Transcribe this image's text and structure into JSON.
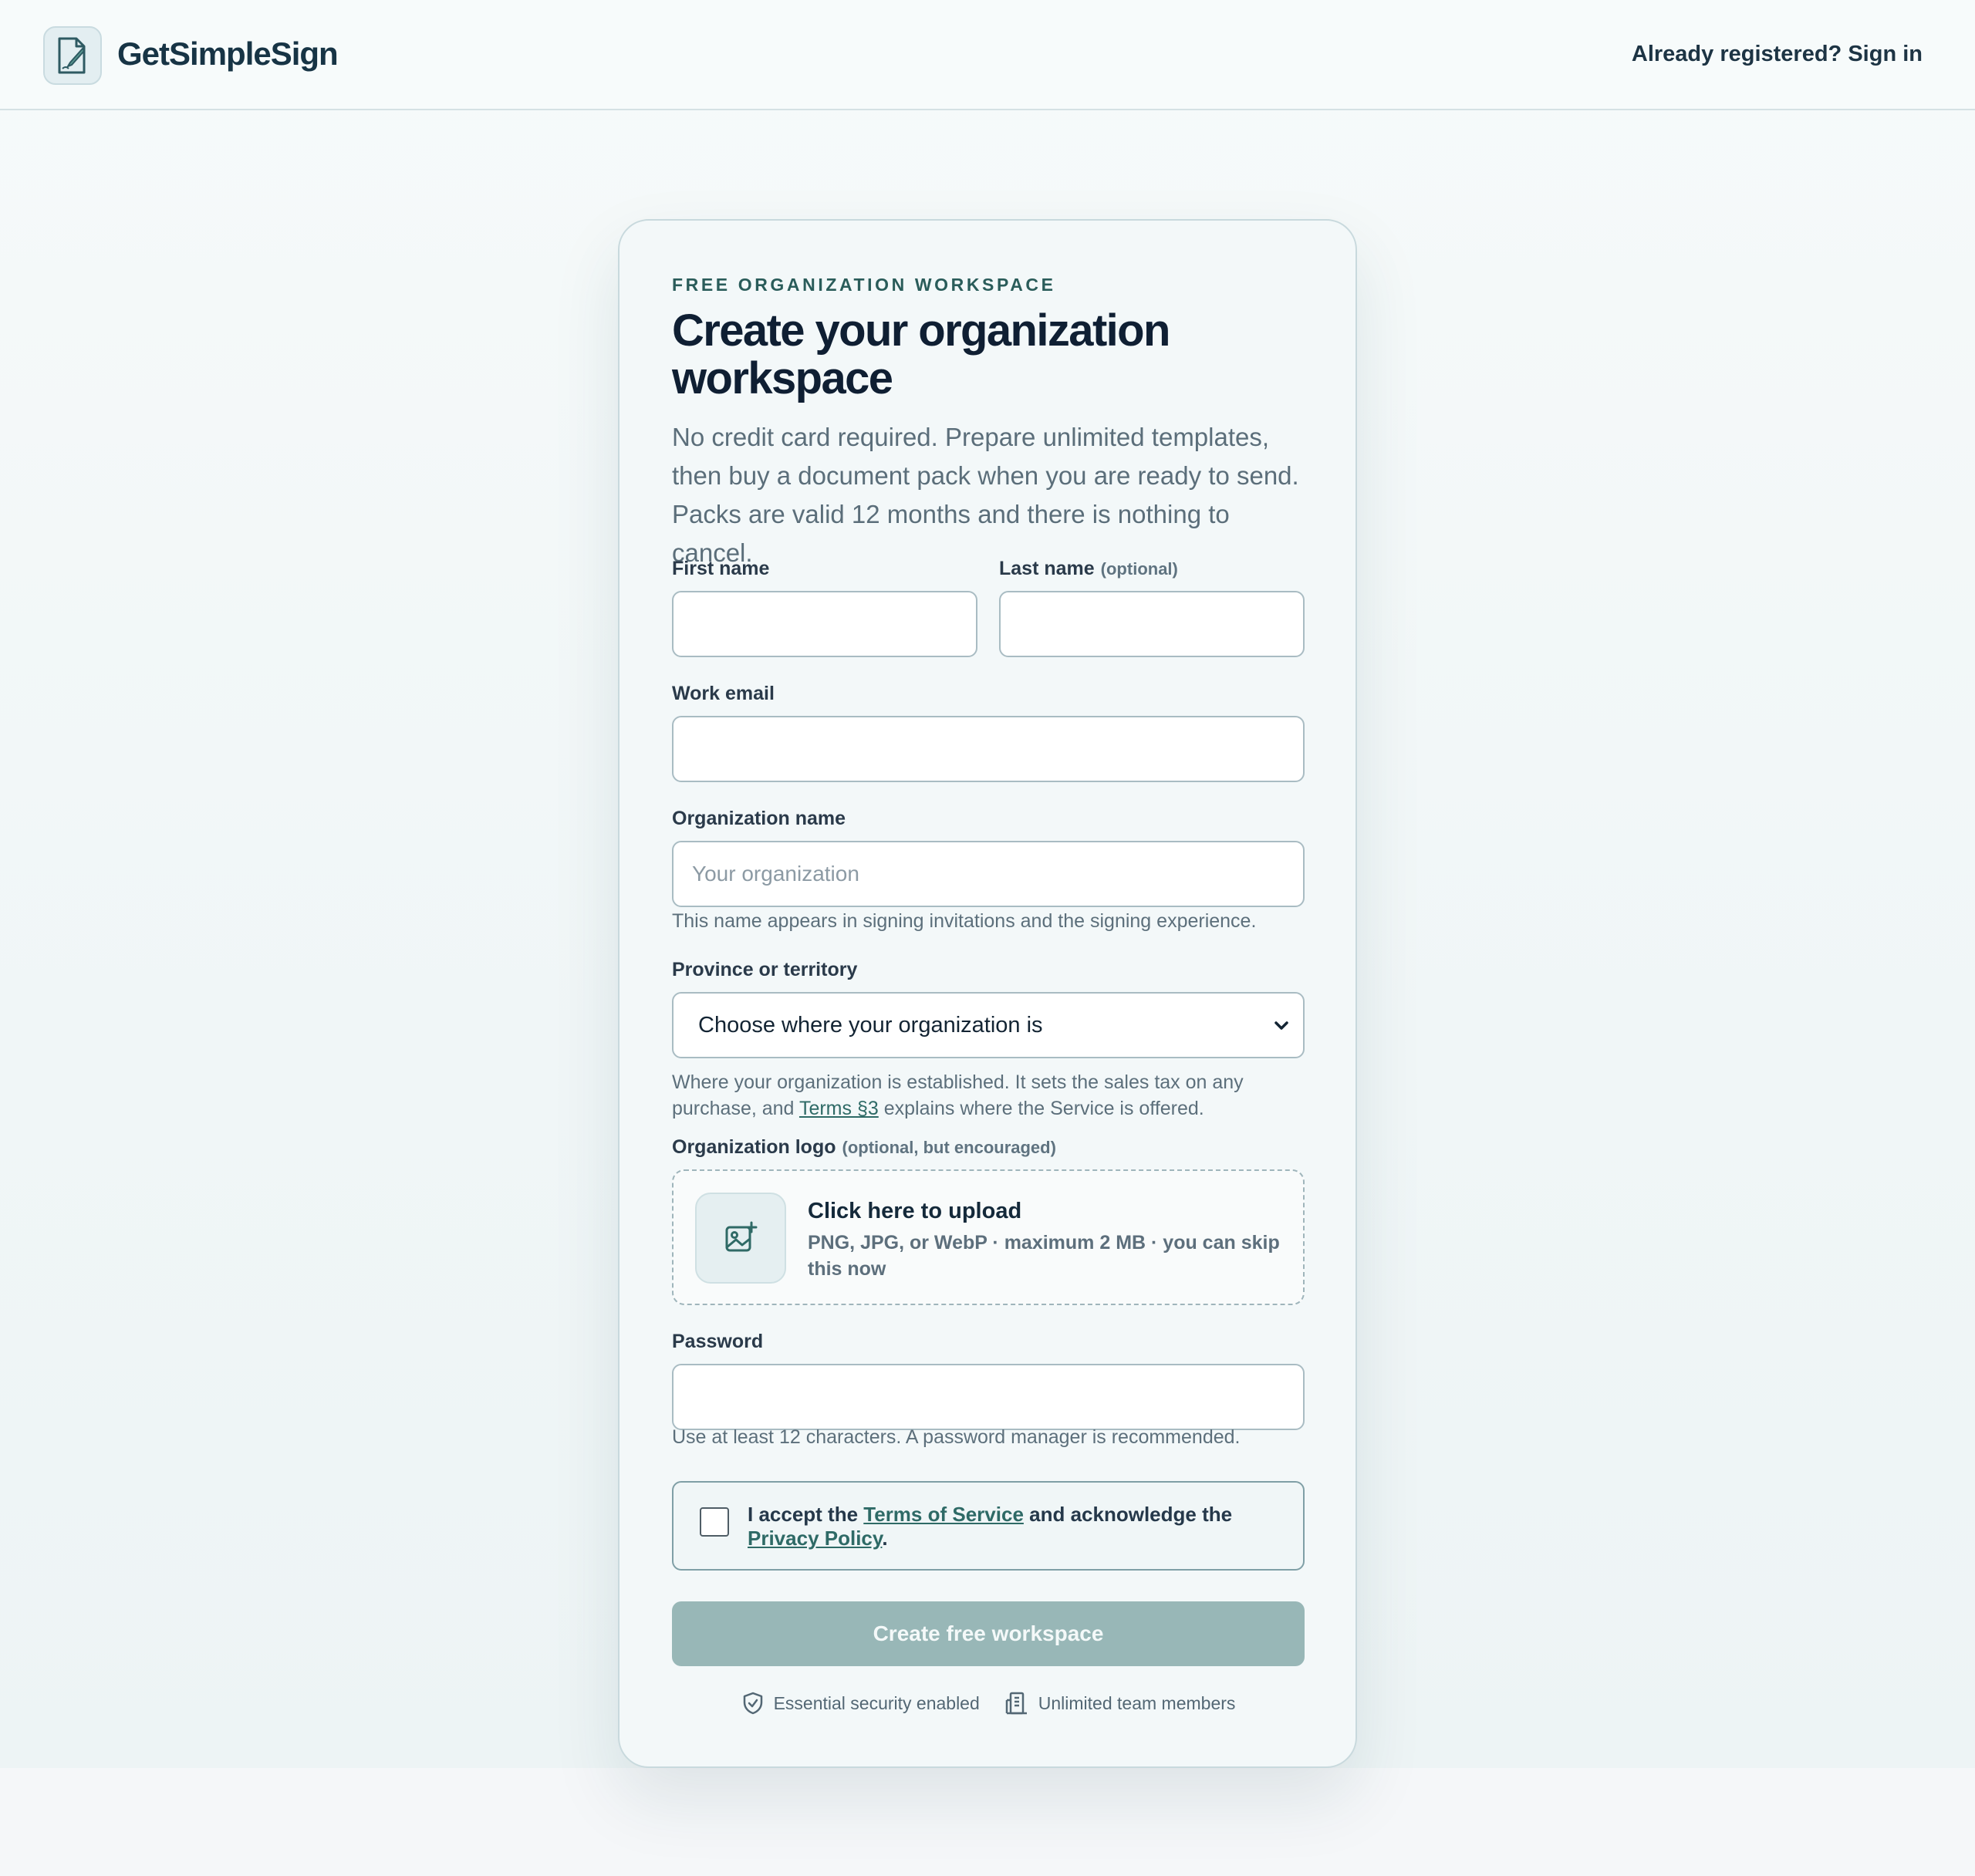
{
  "header": {
    "brand": "GetSimpleSign",
    "signin": "Already registered? Sign in",
    "logo_icon": "document-pen-icon"
  },
  "form": {
    "eyebrow": "FREE ORGANIZATION WORKSPACE",
    "title": "Create your organization workspace",
    "subtitle": "No credit card required. Prepare unlimited templates, then buy a document pack when you are ready to send. Packs are valid 12 months and there is nothing to cancel.",
    "first_name": {
      "label": "First name",
      "value": "",
      "placeholder": ""
    },
    "last_name": {
      "label": "Last name",
      "optional": "(optional)",
      "value": "",
      "placeholder": ""
    },
    "email": {
      "label": "Work email",
      "value": "",
      "placeholder": ""
    },
    "org_name": {
      "label": "Organization name",
      "value": "",
      "placeholder": "Your organization",
      "help": "This name appears in signing invitations and the signing experience."
    },
    "province": {
      "label": "Province or territory",
      "selected": "Choose where your organization is",
      "help_prefix": "Where your organization is established. It sets the sales tax on any purchase, and ",
      "help_link": "Terms §3",
      "help_suffix": " explains where the Service is offered."
    },
    "logo": {
      "label": "Organization logo",
      "optional": "(optional, but encouraged)",
      "upload_title": "Click here to upload",
      "upload_sub": "PNG, JPG, or WebP · maximum 2 MB · you can skip this now",
      "icon": "image-plus-icon"
    },
    "password": {
      "label": "Password",
      "value": "",
      "help": "Use at least 12 characters. A password manager is recommended."
    },
    "terms": {
      "prefix": "I accept the ",
      "tos": "Terms of Service",
      "middle": " and acknowledge the ",
      "privacy": "Privacy Policy",
      "suffix": ".",
      "checked": false
    },
    "submit": "Create free workspace",
    "features": [
      {
        "icon": "shield-check-icon",
        "label": "Essential security enabled"
      },
      {
        "icon": "building-icon",
        "label": "Unlimited team members"
      }
    ]
  },
  "colors": {
    "accent": "#2e6a66",
    "button_disabled": "#98b7b7",
    "title": "#0f1f33"
  }
}
